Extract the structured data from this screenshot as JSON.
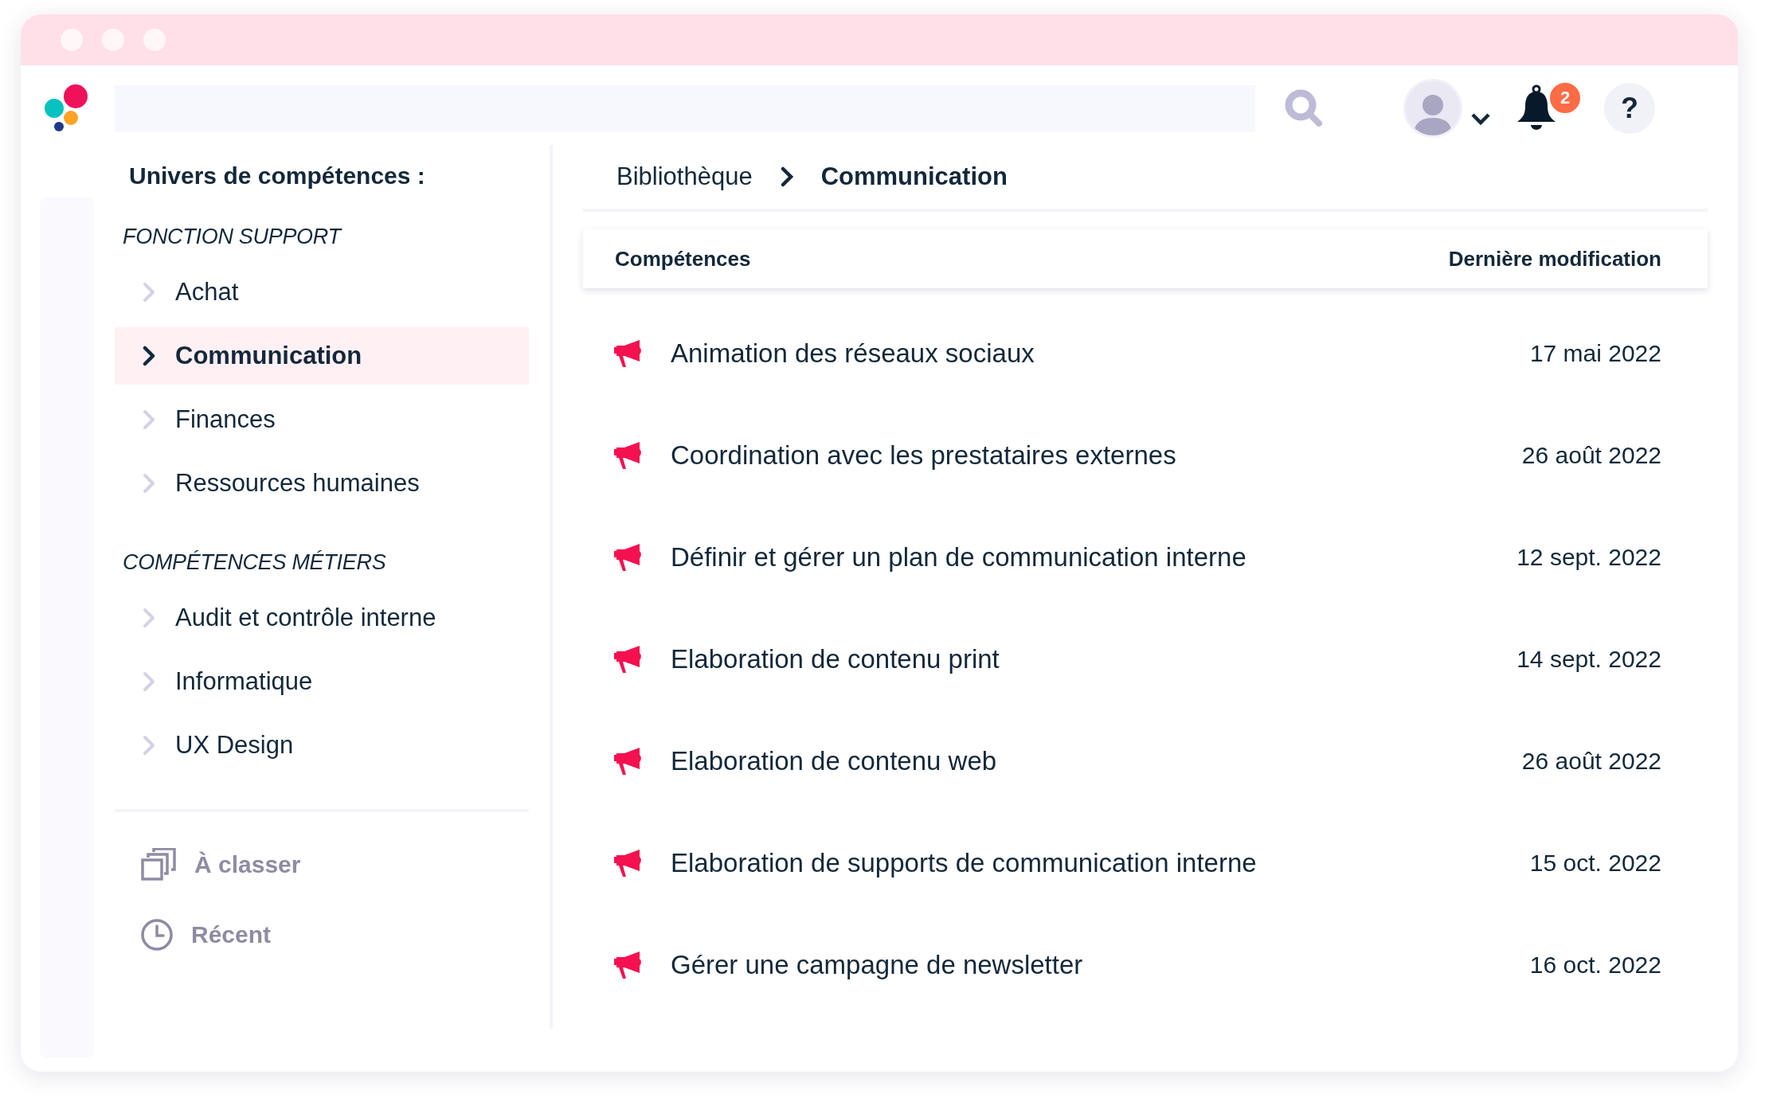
{
  "topbar": {
    "notifications": "2",
    "help": "?"
  },
  "sidebar": {
    "title": "Univers de compétences :",
    "sections": [
      {
        "heading": "FONCTION SUPPORT",
        "items": [
          {
            "label": "Achat",
            "selected": false
          },
          {
            "label": "Communication",
            "selected": true
          },
          {
            "label": "Finances",
            "selected": false
          },
          {
            "label": "Ressources humaines",
            "selected": false
          }
        ]
      },
      {
        "heading": "COMPÉTENCES MÉTIERS",
        "items": [
          {
            "label": "Audit et contrôle interne",
            "selected": false
          },
          {
            "label": "Informatique",
            "selected": false
          },
          {
            "label": "UX Design",
            "selected": false
          }
        ]
      }
    ],
    "links": [
      "À classer",
      "Récent"
    ]
  },
  "breadcrumb": [
    "Bibliothèque",
    "Communication"
  ],
  "table": {
    "columns": [
      "Compétences",
      "Dernière modification"
    ],
    "rows": [
      {
        "name": "Animation des réseaux sociaux",
        "date": "17 mai 2022"
      },
      {
        "name": "Coordination avec les prestataires externes",
        "date": "26 août 2022"
      },
      {
        "name": "Définir et gérer un plan de communication interne",
        "date": "12 sept. 2022"
      },
      {
        "name": "Elaboration de contenu print",
        "date": "14 sept. 2022"
      },
      {
        "name": "Elaboration de contenu web",
        "date": "26 août 2022"
      },
      {
        "name": "Elaboration de supports de communication interne",
        "date": "15 oct. 2022"
      },
      {
        "name": "Gérer une campagne de newsletter",
        "date": "16 oct. 2022"
      }
    ]
  }
}
